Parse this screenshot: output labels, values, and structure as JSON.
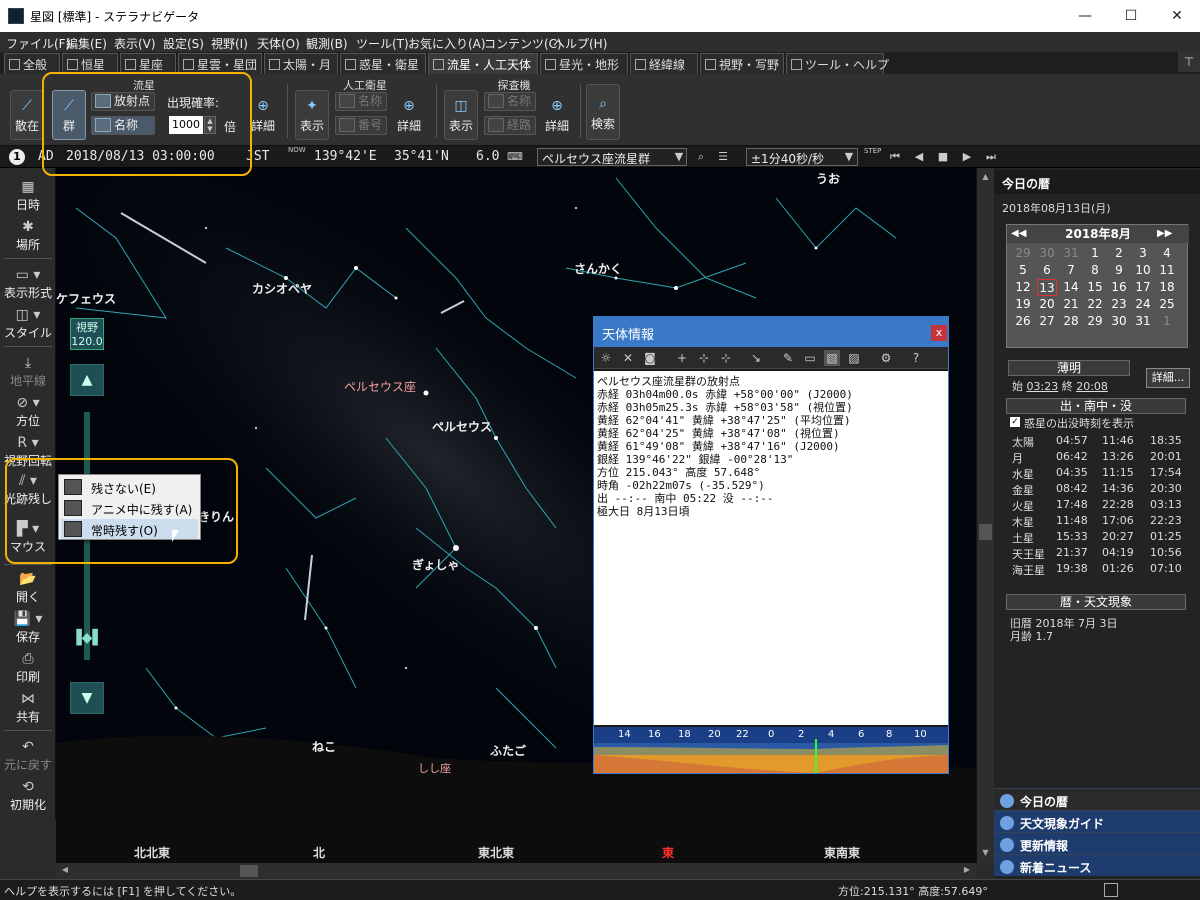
{
  "window": {
    "title": "星図 [標準] - ステラナビゲータ",
    "min": "—",
    "max": "☐",
    "close": "✕"
  },
  "menu": [
    "ファイル(F)",
    "編集(E)",
    "表示(V)",
    "設定(S)",
    "視野(I)",
    "天体(O)",
    "観測(B)",
    "ツール(T)",
    "お気に入り(A)",
    "コンテンツ(C)",
    "ヘルプ(H)"
  ],
  "tabs": [
    "全般",
    "恒星",
    "星座",
    "星雲・星団",
    "太陽・月",
    "惑星・衛星",
    "流星・人工天体",
    "昼光・地形",
    "経緯線",
    "視野・写野",
    "ツール・ヘルプ"
  ],
  "pin": "⊤",
  "ribbon": {
    "meteor": {
      "group": "流星",
      "scatter": "散在",
      "shower": "群",
      "radiant": "放射点",
      "name": "名称",
      "rate_label": "出現確率:",
      "rate_value": "1000",
      "rate_unit": "倍",
      "detail": "詳細"
    },
    "satellite": {
      "group": "人工衛星",
      "show": "表示",
      "name": "名称",
      "number": "番号",
      "detail": "詳細"
    },
    "probe": {
      "group": "探査機",
      "show": "表示",
      "name": "名称",
      "path": "経路",
      "detail": "詳細"
    },
    "search": "検索"
  },
  "timebar": {
    "step": "1",
    "era": "AD",
    "datetime": "2018/08/13 03:00:00",
    "tz": "JST",
    "now": "NOW",
    "longitude": "139°42'E",
    "latitude": "35°41'N",
    "zoom": "6.0",
    "target": "ペルセウス座流星群",
    "speed": "±1分40秒/秒",
    "stepbtn": "STEP"
  },
  "left": {
    "datetime": "日時",
    "place": "場所",
    "display": "表示形式",
    "style": "スタイル",
    "horizon": "地平線",
    "direction": "方位",
    "rotate": "視野回転",
    "trail": "光跡残し",
    "mouse": "マウス",
    "open": "開く",
    "save": "保存",
    "print": "印刷",
    "share": "共有",
    "undo": "元に戻す",
    "reset": "初期化",
    "fov_label": "視野",
    "fov_value": "120.0"
  },
  "popup": {
    "items": [
      "残さない(E)",
      "アニメ中に残す(A)",
      "常時残す(O)"
    ]
  },
  "sky": {
    "labels": [
      "うお",
      "ケフェウス",
      "カシオペヤ",
      "さんかく",
      "ペルセウス座",
      "ペルセウス",
      "きりん",
      "ぎょしゃ",
      "ねこ",
      "ふたご",
      "しし座"
    ],
    "directions": [
      "北北東",
      "北",
      "東北東",
      "東",
      "東南東"
    ]
  },
  "info": {
    "title": "天体情報",
    "close": "x",
    "lines": [
      "ペルセウス座流星群の放射点",
      "赤経 03h04m00.0s  赤緯 +58°00'00\" (J2000)",
      "赤経 03h05m25.3s  赤緯 +58°03'58\" (視位置)",
      "黄経  62°04'41\"  黄緯 +38°47'25\" (平均位置)",
      "黄経  62°04'25\"  黄緯 +38°47'08\" (視位置)",
      "黄経  61°49'08\"  黄緯 +38°47'16\" (J2000)",
      "銀経 139°46'22\"  銀緯 -00°28'13\"",
      "方位 215.043°    高度  57.648°",
      "時角 -02h22m07s (-35.529°)",
      "出 --:-- 南中 05:22 没 --:--",
      "極大日 8月13日頃"
    ],
    "graph_ticks": [
      "14",
      "16",
      "18",
      "20",
      "22",
      "0",
      "2",
      "4",
      "6",
      "8",
      "10"
    ]
  },
  "right": {
    "header": "今日の暦",
    "date": "2018年08月13日(月)",
    "cal": {
      "title": "2018年8月",
      "prev": "◀◀",
      "next": "▶▶",
      "days": [
        "29",
        "30",
        "31",
        "1",
        "2",
        "3",
        "4",
        "5",
        "6",
        "7",
        "8",
        "9",
        "10",
        "11",
        "12",
        "13",
        "14",
        "15",
        "16",
        "17",
        "18",
        "19",
        "20",
        "21",
        "22",
        "23",
        "24",
        "25",
        "26",
        "27",
        "28",
        "29",
        "30",
        "31",
        "1"
      ]
    },
    "twilight": {
      "title": "薄明",
      "start_label": "始",
      "start": "03:23",
      "end_label": "終",
      "end": "20:08",
      "detail": "詳細..."
    },
    "rise": {
      "title": "出・南中・没",
      "check_label": "惑星の出没時刻を表示",
      "rows": [
        [
          "太陽",
          "04:57",
          "11:46",
          "18:35"
        ],
        [
          "月",
          "06:42",
          "13:26",
          "20:01"
        ],
        [
          "水星",
          "04:35",
          "11:15",
          "17:54"
        ],
        [
          "金星",
          "08:42",
          "14:36",
          "20:30"
        ],
        [
          "火星",
          "17:48",
          "22:28",
          "03:13"
        ],
        [
          "木星",
          "11:48",
          "17:06",
          "22:23"
        ],
        [
          "土星",
          "15:33",
          "20:27",
          "01:25"
        ],
        [
          "天王星",
          "21:37",
          "04:19",
          "10:56"
        ],
        [
          "海王星",
          "19:38",
          "01:26",
          "07:10"
        ]
      ]
    },
    "almanac": {
      "title": "暦・天文現象",
      "lunar": "旧暦  2018年 7月 3日",
      "age": "月齢 1.7"
    },
    "tabs": [
      "今日の暦",
      "天文現象ガイド",
      "更新情報",
      "新着ニュース"
    ]
  },
  "status": {
    "help": "ヘルプを表示するには [F1] を押してください。",
    "azalt": "方位:215.131° 高度:57.649°"
  }
}
